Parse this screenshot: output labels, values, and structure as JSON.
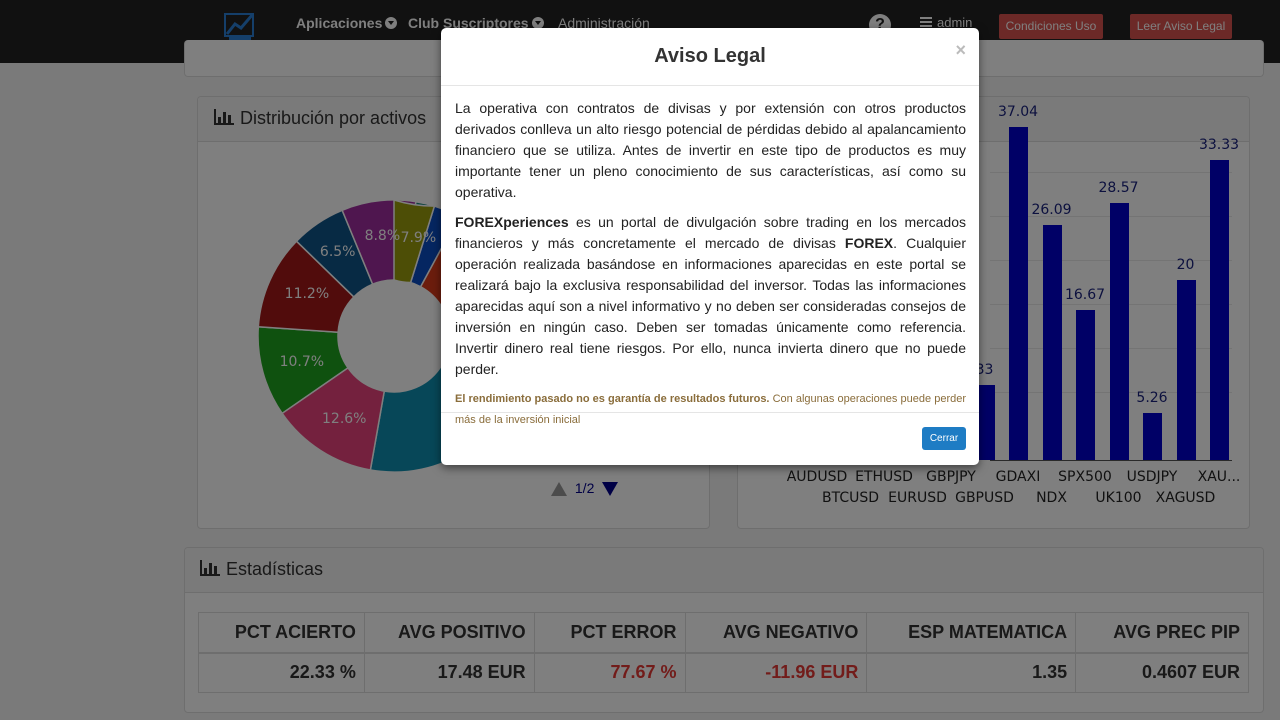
{
  "navbar": {
    "logo_icon": "chart-logo-icon",
    "items": [
      {
        "label": "Aplicaciones"
      },
      {
        "label": "Club Suscriptores"
      },
      {
        "label": "Administración"
      }
    ],
    "help_icon": "question-circle-icon",
    "user_label": "admin",
    "terms_button": "Condiciones Uso",
    "legal_button": "Leer Aviso Legal"
  },
  "distribution_panel": {
    "title": "Distribución por activos",
    "pager": "1/2"
  },
  "chart_data": [
    {
      "type": "pie",
      "values": [
        7.9,
        12.6,
        10.7,
        11.2,
        6.5,
        8.8
      ],
      "labels": [
        "7.9%",
        "12.6%",
        "10.7%",
        "11.2%",
        "6.5%",
        "8.8%"
      ],
      "colors": [
        "#0b4dc2",
        "#e8427c",
        "#1fa31f",
        "#a31818",
        "#0e5488",
        "#9e2c9e",
        "#17857a",
        "#9a9c0c",
        "#d93a1a",
        "#0f8fb0"
      ]
    },
    {
      "type": "bar",
      "categories": [
        "AUDUSD",
        "BTCUSD",
        "ETHUSD",
        "EURUSD",
        "GBPJPY",
        "GBPUSD",
        "GDAXI",
        "NDX",
        "SPX500",
        "UK100",
        "USDJPY",
        "XAGUSD",
        "XAU..."
      ],
      "values": [
        null,
        null,
        null,
        null,
        null,
        8.33,
        37.04,
        26.09,
        16.67,
        28.57,
        5.26,
        20,
        33.33
      ],
      "value_labels": [
        "33",
        "37.04",
        "26.09",
        "16.67",
        "28.57",
        "5.26",
        "20",
        "33.33"
      ],
      "color": "#0000cd"
    }
  ],
  "stats_panel": {
    "title": "Estadísticas",
    "headers": [
      "PCT ACIERTO",
      "AVG POSITIVO",
      "PCT ERROR",
      "AVG NEGATIVO",
      "ESP MATEMATICA",
      "AVG PREC PIP"
    ],
    "values": [
      "22.33 %",
      "17.48 EUR",
      "77.67 %",
      "-11.96 EUR",
      "1.35",
      "0.4607 EUR"
    ]
  },
  "modal": {
    "title": "Aviso Legal",
    "close_symbol": "×",
    "paragraph1": "La operativa con contratos de divisas y por extensión con otros productos derivados conlleva un alto riesgo potencial de pérdidas debido al apalancamiento financiero que se utiliza. Antes de invertir en este tipo de productos es muy importante tener un pleno conocimiento de sus características, así como su operativa.",
    "brand": "FOREXperiences",
    "paragraph2_a": " es un portal de divulgación sobre trading en los mercados financieros y más concretamente el mercado de divisas ",
    "forex": "FOREX",
    "paragraph2_b": ". Cualquier operación realizada basándose en informaciones aparecidas en este portal se realizará bajo la exclusiva responsabilidad del inversor. Todas las informaciones aparecidas aquí son a nivel informativo y no deben ser consideradas consejos de inversión en ningún caso. Deben ser tomadas únicamente como referencia. Invertir dinero real tiene riesgos. Por ello, nunca invierta dinero que no puede perder.",
    "disclaimer_bold": "El rendimiento pasado no es garantía de resultados futuros.",
    "disclaimer_rest": " Con algunas operaciones puede perder más de la inversión inicial",
    "close_button": "Cerrar"
  }
}
